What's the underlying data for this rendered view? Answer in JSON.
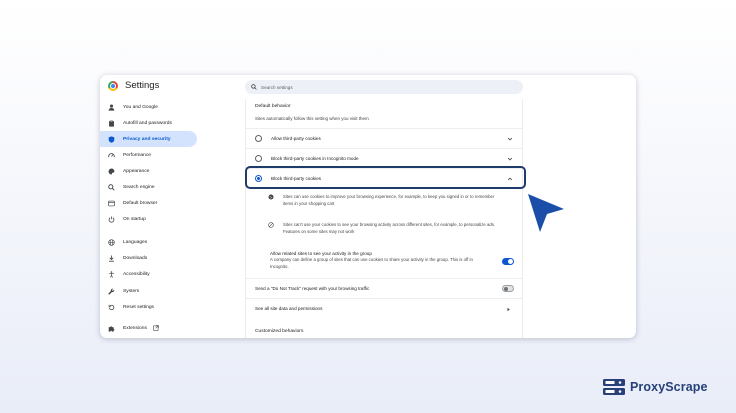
{
  "app": {
    "title": "Settings"
  },
  "search": {
    "placeholder": "Search settings"
  },
  "sidebar": {
    "items": [
      {
        "label": "You and Google",
        "icon": "person-icon"
      },
      {
        "label": "Autofill and passwords",
        "icon": "clipboard-icon"
      },
      {
        "label": "Privacy and security",
        "icon": "shield-icon",
        "active": true
      },
      {
        "label": "Performance",
        "icon": "speedometer-icon"
      },
      {
        "label": "Appearance",
        "icon": "palette-icon"
      },
      {
        "label": "Search engine",
        "icon": "search-icon"
      },
      {
        "label": "Default browser",
        "icon": "browser-icon"
      },
      {
        "label": "On startup",
        "icon": "power-icon"
      },
      {
        "label": "Languages",
        "icon": "globe-icon"
      },
      {
        "label": "Downloads",
        "icon": "download-icon"
      },
      {
        "label": "Accessibility",
        "icon": "accessibility-icon"
      },
      {
        "label": "System",
        "icon": "wrench-icon"
      },
      {
        "label": "Reset settings",
        "icon": "reset-icon"
      },
      {
        "label": "Extensions",
        "icon": "puzzle-icon"
      }
    ]
  },
  "content": {
    "heading": "Default behavior",
    "subheading": "Sites automatically follow this setting when you visit them",
    "options": [
      {
        "label": "Allow third-party cookies",
        "selected": false
      },
      {
        "label": "Block third-party cookies in Incognito mode",
        "selected": false
      },
      {
        "label": "Block third-party cookies",
        "selected": true
      }
    ],
    "details": [
      {
        "icon": "cookie-icon",
        "text": "Sites can use cookies to improve your browsing experience, for example, to keep you signed in or to remember items in your shopping cart"
      },
      {
        "icon": "block-icon",
        "text": "Sites can't use your cookies to see your browsing activity across different sites, for example, to personalize ads. Features on some sites may not work"
      }
    ],
    "related": {
      "title": "Allow related sites to see your activity in the group",
      "description": "A company can define a group of sites that can use cookies to share your activity in the group. This is off in Incognito.",
      "enabled": true
    },
    "dnt": {
      "label": "Send a \"Do Not Track\" request with your browsing traffic",
      "enabled": false
    },
    "site_data_link": "See all site data and permissions",
    "customized_heading": "Customized behaviors"
  },
  "brand": {
    "name": "ProxyScrape"
  },
  "colors": {
    "accent": "#0b57d0",
    "active_bg": "#d3e3fd",
    "highlight": "#1f3b6b",
    "brand": "#27407a",
    "cursor": "#1b4ea8"
  }
}
